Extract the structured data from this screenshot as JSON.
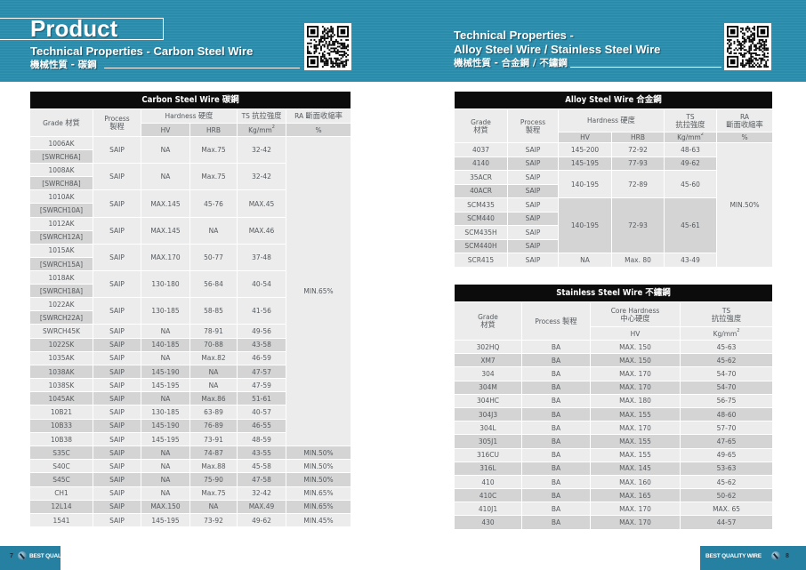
{
  "colors": {
    "banner": "#2b8fb0",
    "footer": "#2580a2",
    "table_title_bg": "#0c0c0c",
    "row_light": "#ececec",
    "row_dark": "#d4d4d4",
    "text": "#555a5e"
  },
  "left_page": {
    "product_title": "Product",
    "subtitle_en": "Technical Properties - Carbon Steel Wire",
    "subtitle_zh": "機械性質 - 碳鋼",
    "qr_icon": "qr-code-icon",
    "page_number": "7",
    "footer_brand": "BEST QUALITY WIRE"
  },
  "right_page": {
    "subtitle_en_line1": "Technical Properties -",
    "subtitle_en_line2": "Alloy Steel Wire / Stainless Steel Wire",
    "subtitle_zh": "機械性質 - 合金鋼 / 不鏽鋼",
    "qr_icon": "qr-code-icon",
    "page_number": "8",
    "footer_brand": "BEST QUALITY WIRE"
  },
  "carbon_table": {
    "title": "Carbon Steel Wire 碳鋼",
    "headers": {
      "grade": "Grade 材質",
      "process_line1": "Process",
      "process_line2": "製程",
      "hardness": "Hardness 硬度",
      "ts": "TS 抗拉強度",
      "ra": "RA 斷面收縮率",
      "hv": "HV",
      "hrb": "HRB",
      "ts_unit": "Kg/mm",
      "ts_unit_sup": "2",
      "ra_unit": "%"
    },
    "paired_rows": [
      {
        "grade": "1006AK",
        "alt_grade": "[SWRCH6A]",
        "process": "SAIP",
        "hv": "NA",
        "hrb": "Max.75",
        "ts": "32-42"
      },
      {
        "grade": "1008AK",
        "alt_grade": "[SWRCH8A]",
        "process": "SAIP",
        "hv": "NA",
        "hrb": "Max.75",
        "ts": "32-42"
      },
      {
        "grade": "1010AK",
        "alt_grade": "[SWRCH10A]",
        "process": "SAIP",
        "hv": "MAX.145",
        "hrb": "45-76",
        "ts": "MAX.45"
      },
      {
        "grade": "1012AK",
        "alt_grade": "[SWRCH12A]",
        "process": "SAIP",
        "hv": "MAX.145",
        "hrb": "NA",
        "ts": "MAX.46"
      },
      {
        "grade": "1015AK",
        "alt_grade": "[SWRCH15A]",
        "process": "SAIP",
        "hv": "MAX.170",
        "hrb": "50-77",
        "ts": "37-48"
      },
      {
        "grade": "1018AK",
        "alt_grade": "[SWRCH18A]",
        "process": "SAIP",
        "hv": "130-180",
        "hrb": "56-84",
        "ts": "40-54"
      },
      {
        "grade": "1022AK",
        "alt_grade": "[SWRCH22A]",
        "process": "SAIP",
        "hv": "130-185",
        "hrb": "58-85",
        "ts": "41-56"
      }
    ],
    "single_rows": [
      {
        "grade": "SWRCH45K",
        "process": "SAIP",
        "hv": "NA",
        "hrb": "78-91",
        "ts": "49-56"
      },
      {
        "grade": "1022SK",
        "process": "SAIP",
        "hv": "140-185",
        "hrb": "70-88",
        "ts": "43-58"
      },
      {
        "grade": "1035AK",
        "process": "SAIP",
        "hv": "NA",
        "hrb": "Max.82",
        "ts": "46-59"
      },
      {
        "grade": "1038AK",
        "process": "SAIP",
        "hv": "145-190",
        "hrb": "NA",
        "ts": "47-57"
      },
      {
        "grade": "1038SK",
        "process": "SAIP",
        "hv": "145-195",
        "hrb": "NA",
        "ts": "47-59"
      },
      {
        "grade": "1045AK",
        "process": "SAIP",
        "hv": "NA",
        "hrb": "Max.86",
        "ts": "51-61"
      },
      {
        "grade": "10B21",
        "process": "SAIP",
        "hv": "130-185",
        "hrb": "63-89",
        "ts": "40-57"
      },
      {
        "grade": "10B33",
        "process": "SAIP",
        "hv": "145-190",
        "hrb": "76-89",
        "ts": "46-55"
      },
      {
        "grade": "10B38",
        "process": "SAIP",
        "hv": "145-195",
        "hrb": "73-91",
        "ts": "48-59"
      }
    ],
    "merged_ra": "MIN.65%",
    "tail_rows": [
      {
        "grade": "S35C",
        "process": "SAIP",
        "hv": "NA",
        "hrb": "74-87",
        "ts": "43-55",
        "ra": "MIN.50%"
      },
      {
        "grade": "S40C",
        "process": "SAIP",
        "hv": "NA",
        "hrb": "Max.88",
        "ts": "45-58",
        "ra": "MIN.50%"
      },
      {
        "grade": "S45C",
        "process": "SAIP",
        "hv": "NA",
        "hrb": "75-90",
        "ts": "47-58",
        "ra": "MIN.50%"
      },
      {
        "grade": "CH1",
        "process": "SAIP",
        "hv": "NA",
        "hrb": "Max.75",
        "ts": "32-42",
        "ra": "MIN.65%"
      },
      {
        "grade": "12L14",
        "process": "SAIP",
        "hv": "MAX.150",
        "hrb": "NA",
        "ts": "MAX.49",
        "ra": "MIN.65%"
      },
      {
        "grade": "1541",
        "process": "SAIP",
        "hv": "145-195",
        "hrb": "73-92",
        "ts": "49-62",
        "ra": "MIN.45%"
      }
    ]
  },
  "alloy_table": {
    "title": "Alloy Steel Wire 合金鋼",
    "headers": {
      "grade_line1": "Grade",
      "grade_line2": "材質",
      "process_line1": "Process",
      "process_line2": "製程",
      "hardness": "Hardness 硬度",
      "ts_line1": "TS",
      "ts_line2": "抗拉強度",
      "ra_line1": "RA",
      "ra_line2": "斷面收縮率",
      "hv": "HV",
      "hrb": "HRB",
      "ts_unit": "Kg/mm",
      "ts_unit_sup": "2",
      "ra_unit": "%"
    },
    "rows": [
      {
        "grade": "4037",
        "process": "SAIP",
        "hv": "145-200",
        "hrb": "72-92",
        "ts": "48-63"
      },
      {
        "grade": "4140",
        "process": "SAIP",
        "hv": "145-195",
        "hrb": "77-93",
        "ts": "49-62"
      },
      {
        "grade": "35ACR",
        "process": "SAIP"
      },
      {
        "grade": "40ACR",
        "process": "SAIP"
      },
      {
        "grade": "SCM435",
        "process": "SAIP"
      },
      {
        "grade": "SCM440",
        "process": "SAIP"
      },
      {
        "grade": "SCM435H",
        "process": "SAIP"
      },
      {
        "grade": "SCM440H",
        "process": "SAIP"
      },
      {
        "grade": "SCR415",
        "process": "SAIP",
        "hv": "NA",
        "hrb": "Max. 80",
        "ts": "43-49"
      }
    ],
    "group_acr": {
      "hv": "140-195",
      "hrb": "72-89",
      "ts": "45-60"
    },
    "group_scm": {
      "hv": "140-195",
      "hrb": "72-93",
      "ts": "45-61"
    },
    "merged_ra": "MIN.50%"
  },
  "stainless_table": {
    "title": "Stainless Steel Wire 不鏽鋼",
    "headers": {
      "grade_line1": "Grade",
      "grade_line2": "材質",
      "process": "Process 製程",
      "core_line1": "Core Hardness",
      "core_line2": "中心硬度",
      "ts_line1": "TS",
      "ts_line2": "抗拉強度",
      "hv": "HV",
      "ts_unit": "Kg/mm",
      "ts_unit_sup": "2"
    },
    "rows": [
      {
        "grade": "302HQ",
        "process": "BA",
        "hv": "MAX. 150",
        "ts": "45-63"
      },
      {
        "grade": "XM7",
        "process": "BA",
        "hv": "MAX. 150",
        "ts": "45-62"
      },
      {
        "grade": "304",
        "process": "BA",
        "hv": "MAX. 170",
        "ts": "54-70"
      },
      {
        "grade": "304M",
        "process": "BA",
        "hv": "MAX. 170",
        "ts": "54-70"
      },
      {
        "grade": "304HC",
        "process": "BA",
        "hv": "MAX. 180",
        "ts": "56-75"
      },
      {
        "grade": "304J3",
        "process": "BA",
        "hv": "MAX. 155",
        "ts": "48-60"
      },
      {
        "grade": "304L",
        "process": "BA",
        "hv": "MAX. 170",
        "ts": "57-70"
      },
      {
        "grade": "305J1",
        "process": "BA",
        "hv": "MAX. 155",
        "ts": "47-65"
      },
      {
        "grade": "316CU",
        "process": "BA",
        "hv": "MAX. 155",
        "ts": "49-65"
      },
      {
        "grade": "316L",
        "process": "BA",
        "hv": "MAX. 145",
        "ts": "53-63"
      },
      {
        "grade": "410",
        "process": "BA",
        "hv": "MAX. 160",
        "ts": "45-62"
      },
      {
        "grade": "410C",
        "process": "BA",
        "hv": "MAX. 165",
        "ts": "50-62"
      },
      {
        "grade": "410J1",
        "process": "BA",
        "hv": "MAX. 170",
        "ts": "MAX. 65"
      },
      {
        "grade": "430",
        "process": "BA",
        "hv": "MAX. 170",
        "ts": "44-57"
      }
    ]
  }
}
